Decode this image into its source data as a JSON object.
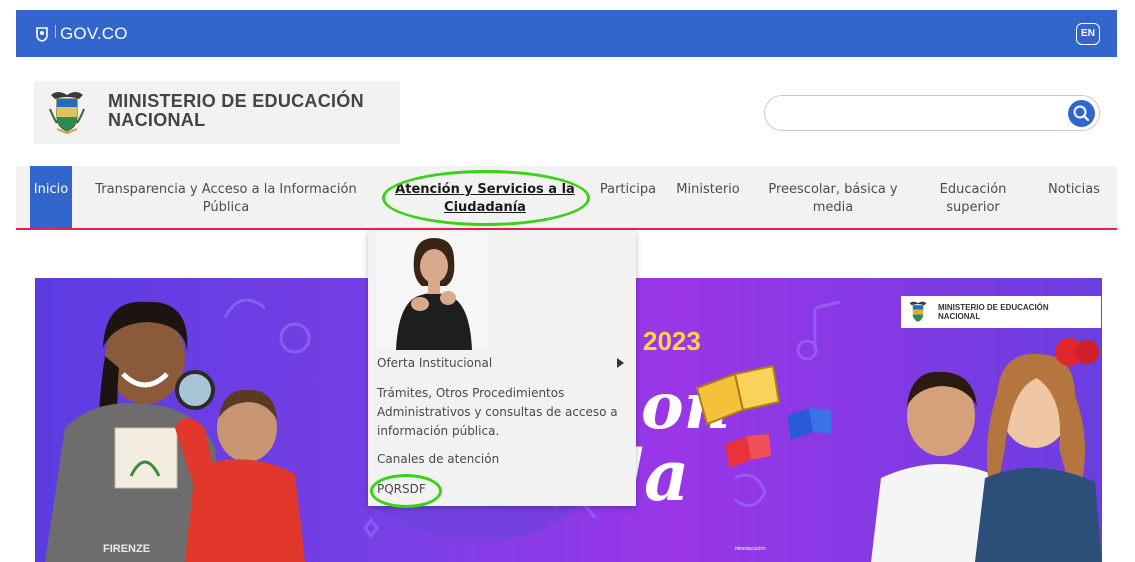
{
  "gov_bar": {
    "logo_text": "GOV.CO",
    "language_button": "EN"
  },
  "header": {
    "brand_line1": "MINISTERIO DE EDUCACIÓN",
    "brand_line2": "NACIONAL",
    "search_placeholder": ""
  },
  "nav": {
    "items": [
      {
        "label_line1": "Inicio",
        "label_line2": ""
      },
      {
        "label_line1": "Transparencia y Acceso a la Información",
        "label_line2": "Pública"
      },
      {
        "label_line1": "Atención y Servicios a la",
        "label_line2": "Ciudadanía"
      },
      {
        "label_line1": "Participa",
        "label_line2": ""
      },
      {
        "label_line1": "Ministerio",
        "label_line2": ""
      },
      {
        "label_line1": "Preescolar, básica y",
        "label_line2": "media"
      },
      {
        "label_line1": "Educación",
        "label_line2": "superior"
      },
      {
        "label_line1": "Noticias",
        "label_line2": ""
      }
    ]
  },
  "dropdown": {
    "items": [
      {
        "label": "Oferta Institucional"
      },
      {
        "line1": "Trámites, Otros Procedimientos",
        "line2": "Administrativos y consultas de acceso a",
        "line3": "información pública."
      },
      {
        "label": "Canales de atención"
      },
      {
        "label": "PQRSDF"
      }
    ]
  },
  "banner": {
    "logo_line1": "MINISTERIO DE EDUCACIÓN",
    "logo_line2": "NACIONAL",
    "year_text": "2023",
    "big_text_1": "on",
    "big_text_2": "da",
    "shirt_text": "FIRENZE"
  },
  "colors": {
    "gov_blue": "#3366cc",
    "nav_underline": "#e6244d",
    "highlight_green": "#39d214",
    "banner_purple": "#7a3fe6"
  },
  "icons": {
    "search": "search-icon",
    "seal": "coat-of-arms-icon",
    "submenu": "caret-right-icon"
  }
}
